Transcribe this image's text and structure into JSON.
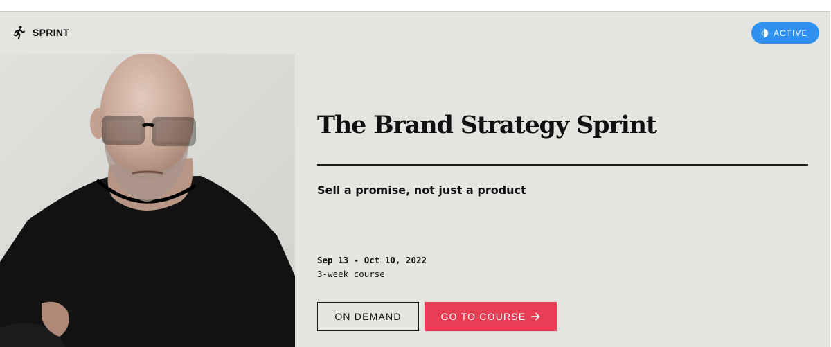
{
  "header": {
    "brand_label": "SPRINT",
    "brand_icon": "running-person-icon",
    "status_label": "ACTIVE",
    "status_icon": "half-circle-progress-icon"
  },
  "course": {
    "title": "The Brand Strategy Sprint",
    "subtitle": "Sell a promise, not just a product",
    "dates": "Sep 13 - Oct 10, 2022",
    "duration": "3-week course"
  },
  "actions": {
    "on_demand_label": "ON DEMAND",
    "go_to_course_label": "GO TO COURSE",
    "go_to_course_icon": "arrow-right-icon"
  },
  "colors": {
    "card_background": "#e4e4e0",
    "status_pill": "#2f90f0",
    "primary_button": "#e83e55",
    "text": "#111111"
  }
}
